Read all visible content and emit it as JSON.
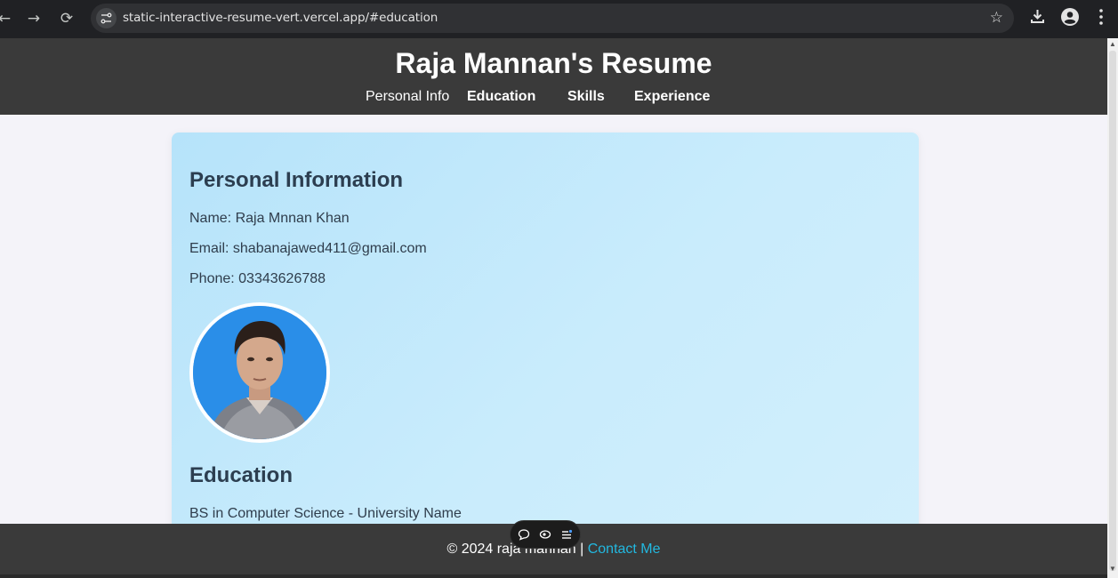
{
  "browser": {
    "url": "static-interactive-resume-vert.vercel.app/#education",
    "icons": [
      "back-arrow-icon",
      "forward-arrow-icon",
      "reload-icon",
      "site-settings-icon",
      "bookmark-star-icon",
      "download-icon",
      "profile-icon",
      "menu-kebab-icon"
    ]
  },
  "header": {
    "title": "Raja Mannan's Resume",
    "nav": [
      {
        "label": "Personal Info"
      },
      {
        "label": "Education"
      },
      {
        "label": "Skills"
      },
      {
        "label": "Experience"
      }
    ]
  },
  "personal": {
    "heading": "Personal Information",
    "name": "Name: Raja Mnnan Khan",
    "email": "Email: shabanajawed411@gmail.com",
    "phone": "Phone: 03343626788"
  },
  "education": {
    "heading": "Education",
    "degree": "BS in Computer Science - University Name"
  },
  "footer": {
    "copyright": "© 2024 raja mannan | ",
    "contact_link": "Contact Me"
  },
  "colors": {
    "header_bg": "#3a3a3a",
    "card_bg": "#c3e8fb",
    "heading_text": "#2c3e50",
    "link": "#22b8e0"
  }
}
